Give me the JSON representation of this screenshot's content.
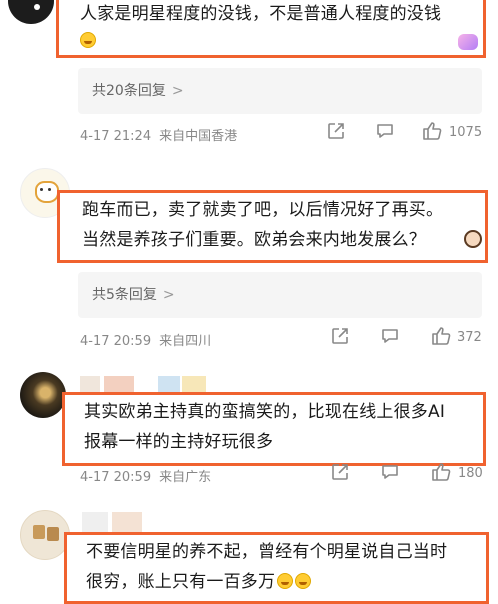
{
  "comments": [
    {
      "text_lines": [
        "人家是明星程度的没钱，不是普通人程度的没钱"
      ],
      "has_lol_emoji": true,
      "replies_label": "共20条回复",
      "time": "4-17 21:24",
      "location": "来自中国香港",
      "likes": "1075"
    },
    {
      "text_lines": [
        "跑车而已，卖了就卖了吧，以后情况好了再买。",
        "当然是养孩子们重要。欧弟会来内地发展么？"
      ],
      "has_lol_emoji": false,
      "replies_label": "共5条回复",
      "time": "4-17 20:59",
      "location": "来自四川",
      "likes": "372"
    },
    {
      "text_lines": [
        "其实欧弟主持真的蛮搞笑的，比现在线上很多AI",
        "报幕一样的主持好玩很多"
      ],
      "has_lol_emoji": false,
      "replies_label": "",
      "time": "4-17 20:59",
      "location": "来自广东",
      "likes": "180"
    },
    {
      "text_lines": [
        "不要信明星的养不起，曾经有个明星说自己当时",
        "很穷，账上只有一百多万"
      ],
      "has_lol_emoji": true,
      "replies_label": "",
      "time": "",
      "location": "",
      "likes": ""
    }
  ],
  "icons": {
    "share": "share-icon",
    "comment": "comment-icon",
    "like": "thumbs-up-icon",
    "reply_more": "chevron-right-icon"
  },
  "colors": {
    "highlight_border": "#f0622f",
    "meta_text": "#888888",
    "reply_bg": "#f5f5f5"
  }
}
